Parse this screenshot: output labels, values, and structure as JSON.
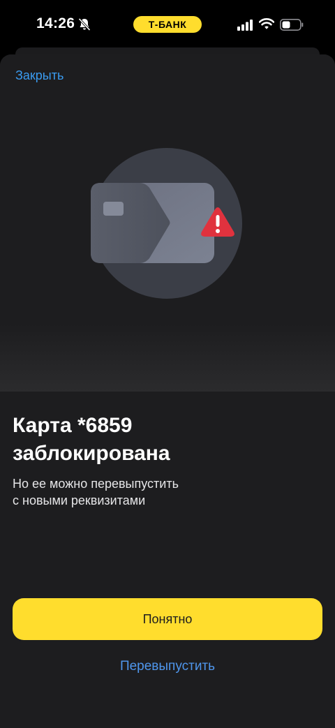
{
  "status_bar": {
    "time": "14:26",
    "bank_label": "Т-БАНК"
  },
  "sheet": {
    "close_label": "Закрыть",
    "title_line1": "Карта *6859",
    "title_line2": "заблокирована",
    "subtitle_line1": "Но ее можно перевыпустить",
    "subtitle_line2": "с новыми реквизитами",
    "primary_button_label": "Понятно",
    "secondary_button_label": "Перевыпустить"
  },
  "colors": {
    "accent_yellow": "#ffdd2d",
    "link_blue": "#3a9bf0",
    "warning_red": "#e0323e",
    "sheet_background": "#1d1d1f"
  },
  "icons": [
    "bell-muted-icon",
    "cellular-signal-icon",
    "wifi-icon",
    "battery-icon",
    "blocked-card-illustration",
    "warning-icon"
  ]
}
